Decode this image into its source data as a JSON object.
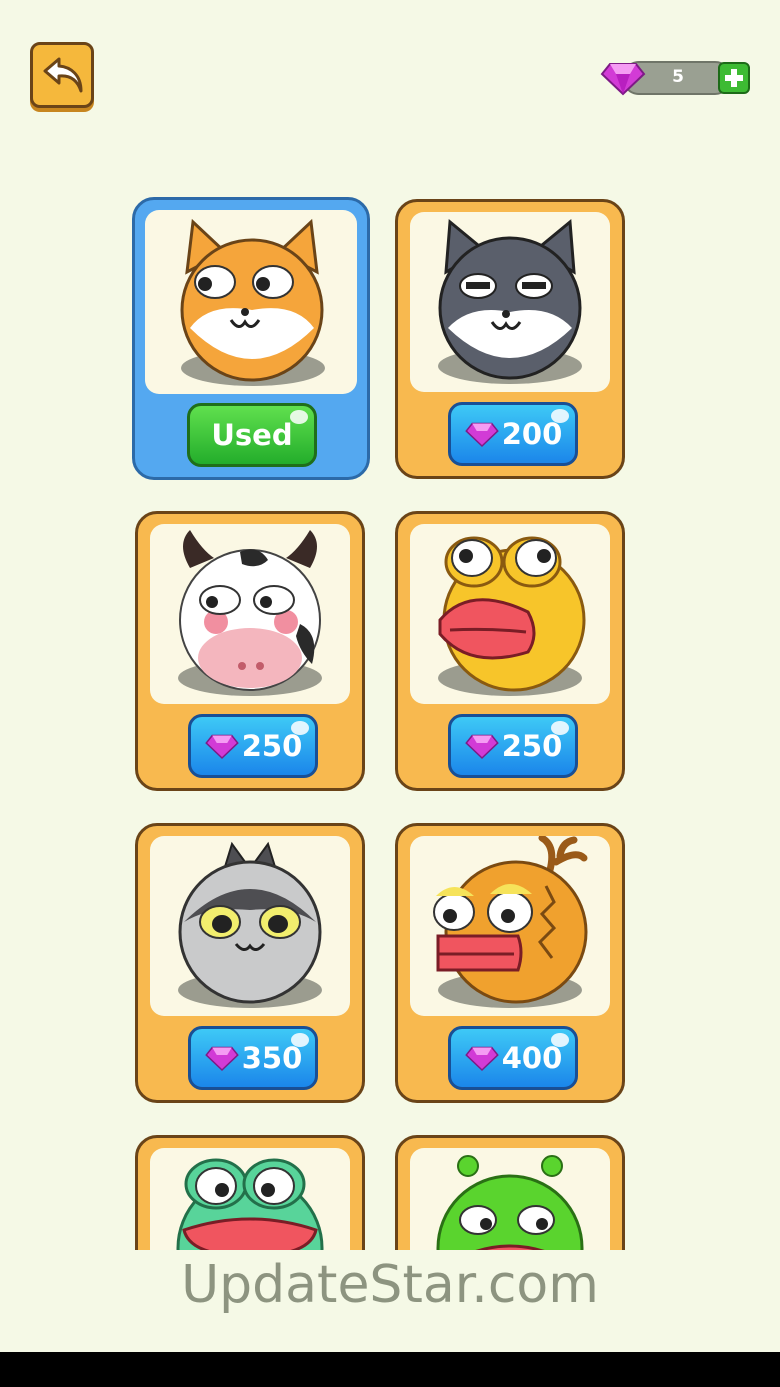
{
  "header": {
    "back_icon": "back-arrow-icon",
    "gem_count": "5",
    "gem_icon": "gem-icon",
    "add_icon": "plus-icon"
  },
  "skins": [
    {
      "name": "shiba",
      "button": "Used",
      "state": "selected"
    },
    {
      "name": "husky",
      "button": "200",
      "state": "locked"
    },
    {
      "name": "cow",
      "button": "250",
      "state": "locked"
    },
    {
      "name": "duck",
      "button": "250",
      "state": "locked"
    },
    {
      "name": "cat",
      "button": "350",
      "state": "locked"
    },
    {
      "name": "dragon",
      "button": "400",
      "state": "locked"
    },
    {
      "name": "frog",
      "button": "",
      "state": "locked"
    },
    {
      "name": "alien",
      "button": "",
      "state": "locked"
    }
  ],
  "watermark": "UpdateStar.com",
  "colors": {
    "background": "#f5f9e6",
    "card": "#f8b94f",
    "card_selected": "#54a8f0",
    "price_button": "#1b86ea",
    "used_button": "#23ad2b"
  }
}
